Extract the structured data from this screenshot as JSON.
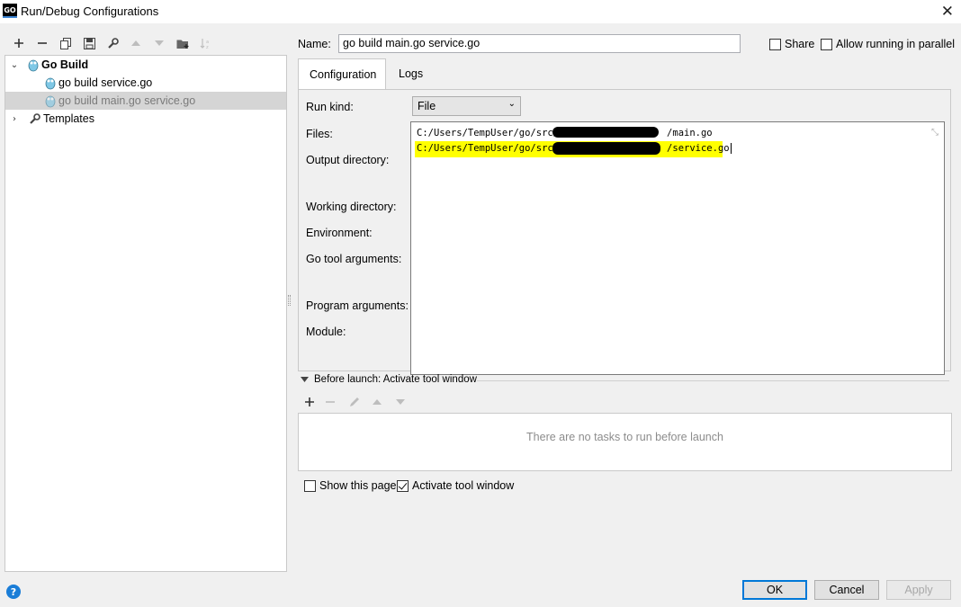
{
  "window": {
    "title": "Run/Debug Configurations",
    "app_badge": "GO"
  },
  "tree": {
    "items": [
      {
        "label": "Go Build"
      },
      {
        "label": "go build service.go"
      },
      {
        "label": "go build main.go service.go"
      },
      {
        "label": "Templates"
      }
    ]
  },
  "form": {
    "name_label": "Name:",
    "name_value": "go build main.go service.go",
    "share_label": "Share",
    "allow_parallel_label": "Allow running in parallel",
    "tabs": [
      {
        "label": "Configuration"
      },
      {
        "label": "Logs"
      }
    ],
    "run_kind_label": "Run kind:",
    "run_kind_value": "File",
    "files_label": "Files:",
    "output_dir_label": "Output directory:",
    "working_dir_label": "Working directory:",
    "environment_label": "Environment:",
    "go_tool_args_label": "Go tool arguments:",
    "program_args_label": "Program arguments:",
    "module_label": "Module:",
    "files": [
      {
        "prefix": "C:/Users/TempUser/go/src/",
        "suffix": "/main.go"
      },
      {
        "prefix": "C:/Users/TempUser/go/src/",
        "suffix": "/service.go"
      }
    ]
  },
  "before_launch": {
    "header": "Before launch: Activate tool window",
    "empty_text": "There are no tasks to run before launch",
    "show_page_label": "Show this page",
    "activate_tool_window_label": "Activate tool window"
  },
  "buttons": {
    "ok": "OK",
    "cancel": "Cancel",
    "apply": "Apply",
    "help": "?"
  },
  "colors": {
    "highlight": "#ffff00",
    "focus_border": "#0078d7",
    "selected_row": "#d5d5d5"
  }
}
